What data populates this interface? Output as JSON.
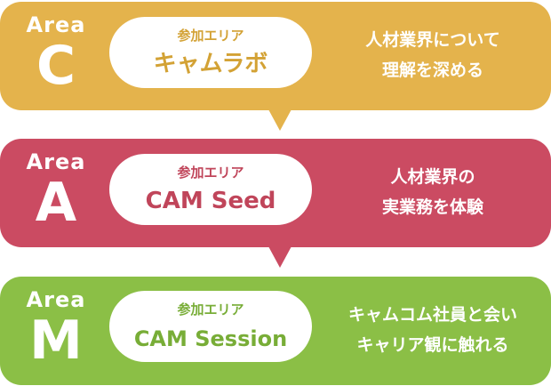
{
  "areas": [
    {
      "key": "c",
      "area_label": "Area",
      "letter": "C",
      "pill_caption": "参加エリア",
      "pill_title": "キャムラボ",
      "desc_line1": "人材業界について",
      "desc_line2": "理解を深める",
      "color": "#e4b34c"
    },
    {
      "key": "a",
      "area_label": "Area",
      "letter": "A",
      "pill_caption": "参加エリア",
      "pill_title": "CAM Seed",
      "desc_line1": "人材業界の",
      "desc_line2": "実業務を体験",
      "color": "#cb4b62"
    },
    {
      "key": "m",
      "area_label": "Area",
      "letter": "M",
      "pill_caption": "参加エリア",
      "pill_title": "CAM Session",
      "desc_line1": "キャムコム社員と会い",
      "desc_line2": "キャリア観に触れる",
      "color": "#8bbf46"
    }
  ]
}
